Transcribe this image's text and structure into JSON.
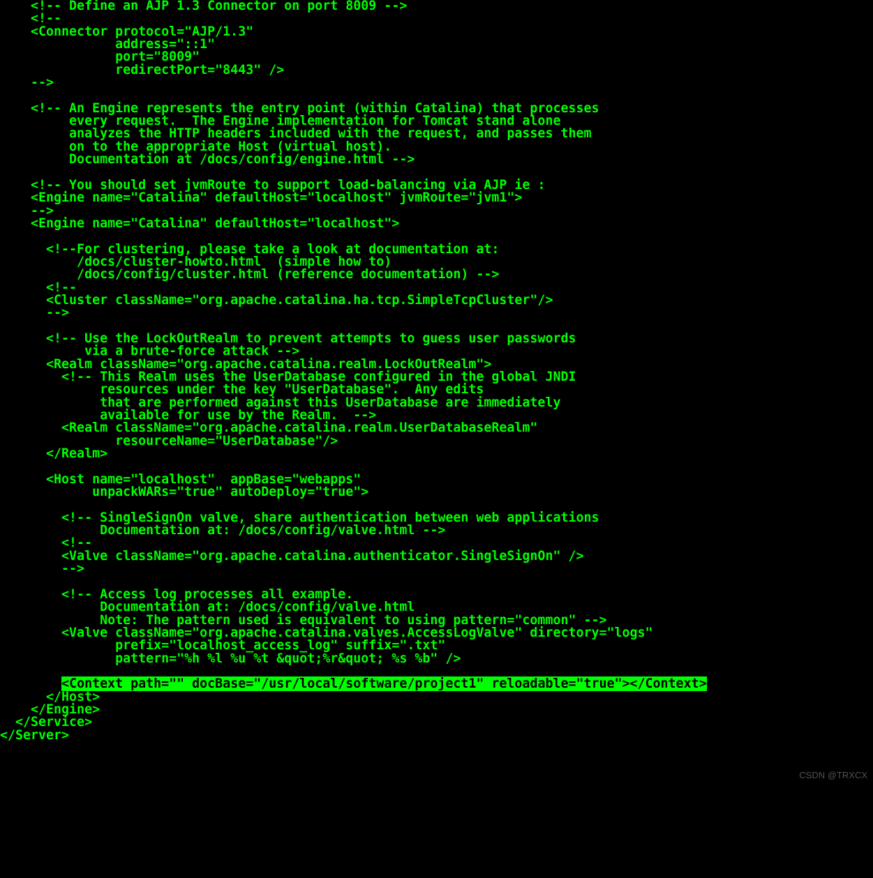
{
  "lines": [
    {
      "t": "    <!-- Define an AJP 1.3 Connector on port 8009 -->"
    },
    {
      "t": "    <!--"
    },
    {
      "t": "    <Connector protocol=\"AJP/1.3\""
    },
    {
      "t": "               address=\"::1\""
    },
    {
      "t": "               port=\"8009\""
    },
    {
      "t": "               redirectPort=\"8443\" />"
    },
    {
      "t": "    -->"
    },
    {
      "t": ""
    },
    {
      "t": "    <!-- An Engine represents the entry point (within Catalina) that processes"
    },
    {
      "t": "         every request.  The Engine implementation for Tomcat stand alone"
    },
    {
      "t": "         analyzes the HTTP headers included with the request, and passes them"
    },
    {
      "t": "         on to the appropriate Host (virtual host)."
    },
    {
      "t": "         Documentation at /docs/config/engine.html -->"
    },
    {
      "t": ""
    },
    {
      "t": "    <!-- You should set jvmRoute to support load-balancing via AJP ie :"
    },
    {
      "t": "    <Engine name=\"Catalina\" defaultHost=\"localhost\" jvmRoute=\"jvm1\">"
    },
    {
      "t": "    -->"
    },
    {
      "t": "    <Engine name=\"Catalina\" defaultHost=\"localhost\">"
    },
    {
      "t": ""
    },
    {
      "t": "      <!--For clustering, please take a look at documentation at:"
    },
    {
      "t": "          /docs/cluster-howto.html  (simple how to)"
    },
    {
      "t": "          /docs/config/cluster.html (reference documentation) -->"
    },
    {
      "t": "      <!--"
    },
    {
      "t": "      <Cluster className=\"org.apache.catalina.ha.tcp.SimpleTcpCluster\"/>"
    },
    {
      "t": "      -->"
    },
    {
      "t": ""
    },
    {
      "t": "      <!-- Use the LockOutRealm to prevent attempts to guess user passwords"
    },
    {
      "t": "           via a brute-force attack -->"
    },
    {
      "t": "      <Realm className=\"org.apache.catalina.realm.LockOutRealm\">"
    },
    {
      "t": "        <!-- This Realm uses the UserDatabase configured in the global JNDI"
    },
    {
      "t": "             resources under the key \"UserDatabase\".  Any edits"
    },
    {
      "t": "             that are performed against this UserDatabase are immediately"
    },
    {
      "t": "             available for use by the Realm.  -->"
    },
    {
      "t": "        <Realm className=\"org.apache.catalina.realm.UserDatabaseRealm\""
    },
    {
      "t": "               resourceName=\"UserDatabase\"/>"
    },
    {
      "t": "      </Realm>"
    },
    {
      "t": ""
    },
    {
      "t": "      <Host name=\"localhost\"  appBase=\"webapps\""
    },
    {
      "t": "            unpackWARs=\"true\" autoDeploy=\"true\">"
    },
    {
      "t": ""
    },
    {
      "t": "        <!-- SingleSignOn valve, share authentication between web applications"
    },
    {
      "t": "             Documentation at: /docs/config/valve.html -->"
    },
    {
      "t": "        <!--"
    },
    {
      "t": "        <Valve className=\"org.apache.catalina.authenticator.SingleSignOn\" />"
    },
    {
      "t": "        -->"
    },
    {
      "t": ""
    },
    {
      "t": "        <!-- Access log processes all example."
    },
    {
      "t": "             Documentation at: /docs/config/valve.html"
    },
    {
      "t": "             Note: The pattern used is equivalent to using pattern=\"common\" -->"
    },
    {
      "t": "        <Valve className=\"org.apache.catalina.valves.AccessLogValve\" directory=\"logs\""
    },
    {
      "t": "               prefix=\"localhost_access_log\" suffix=\".txt\""
    },
    {
      "t": "               pattern=\"%h %l %u %t &quot;%r&quot; %s %b\" />"
    },
    {
      "t": ""
    },
    {
      "t": "        ",
      "hl": "<Context path=\"\" docBase=\"/usr/local/software/project1\" reloadable=\"true\"></Context>"
    },
    {
      "t": "      </Host>"
    },
    {
      "t": "    </Engine>"
    },
    {
      "t": "  </Service>"
    },
    {
      "t": "</Server>"
    }
  ],
  "watermark": "CSDN @TRXCX"
}
